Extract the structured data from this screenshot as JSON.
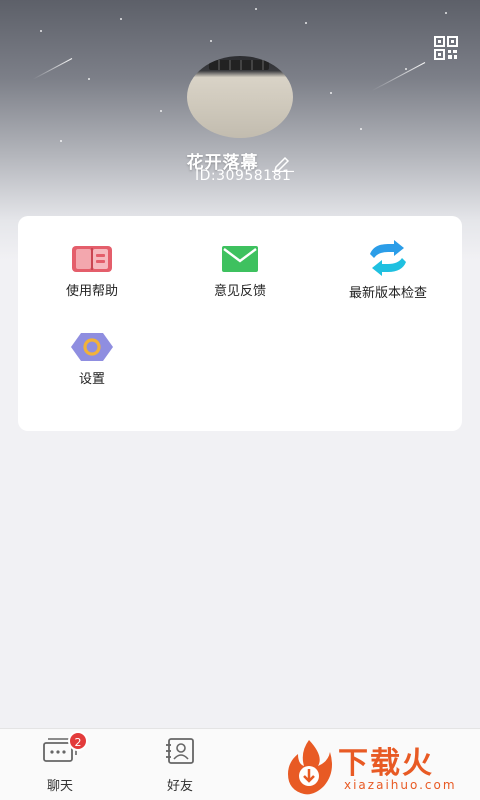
{
  "header": {
    "nickname": "花开落幕",
    "user_id": "ID:30958181",
    "qr_icon": "qr-code-icon",
    "edit_icon": "pencil-icon"
  },
  "menu": {
    "items": [
      {
        "label": "使用帮助",
        "icon": "book-icon"
      },
      {
        "label": "意见反馈",
        "icon": "envelope-icon"
      },
      {
        "label": "最新版本检查",
        "icon": "refresh-icon"
      },
      {
        "label": "设置",
        "icon": "gear-icon"
      }
    ]
  },
  "tabbar": {
    "chat_label": "聊天",
    "chat_badge": "2",
    "friends_label": "好友"
  },
  "watermark": {
    "title": "下载火",
    "site": "xiazaihuo.com"
  },
  "colors": {
    "accent": "#e85a24",
    "badge": "#e33b3b",
    "card": "#ffffff",
    "background": "#f1f1f4"
  }
}
